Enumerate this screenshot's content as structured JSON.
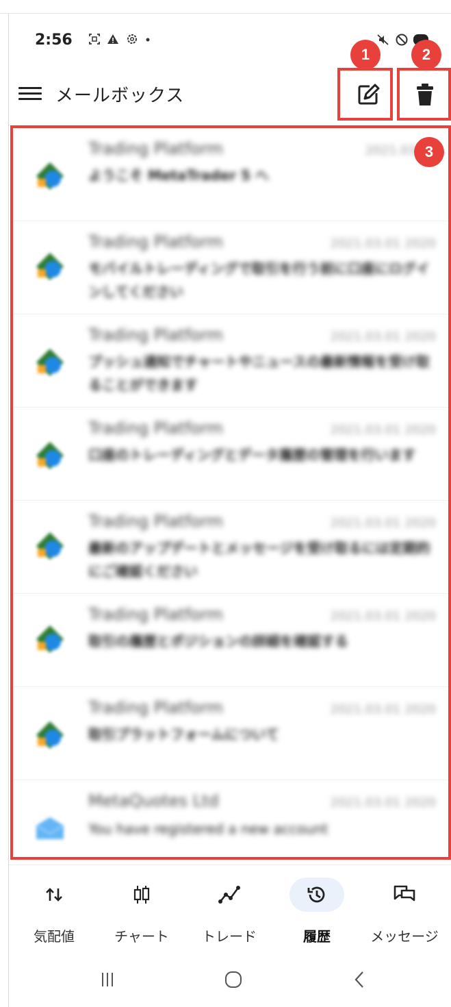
{
  "status_bar": {
    "time": "2:56",
    "left_icons": [
      "screenshot-icon",
      "warning-icon",
      "settings-icon",
      "dot-icon"
    ],
    "right_icons": [
      "mute-icon",
      "do-not-disturb-icon",
      "battery-icon"
    ]
  },
  "app_bar": {
    "title": "メールボックス",
    "compose_icon": "compose-icon",
    "delete_icon": "trash-icon"
  },
  "annotations": {
    "badge_1": "1",
    "badge_2": "2",
    "badge_3": "3",
    "color": "#e8403a"
  },
  "mail_list": {
    "items": [
      {
        "sender": "Trading Platform",
        "date": "2021.03.01",
        "subject": "ようこそ MetaTrader 5 へ"
      },
      {
        "sender": "Trading Platform",
        "date": "2021.03.01 2020",
        "subject": "モバイルトレーディングで取引を行う前に口座にログインしてください"
      },
      {
        "sender": "Trading Platform",
        "date": "2021.03.01 2020",
        "subject": "プッシュ通知でチャートやニュースの最新情報を受け取ることができます"
      },
      {
        "sender": "Trading Platform",
        "date": "2021.03.01 2020",
        "subject": "口座のトレーディングとデータ履歴の管理を行います"
      },
      {
        "sender": "Trading Platform",
        "date": "2021.03.01 2020",
        "subject": "最新のアップデートとメッセージを受け取るには定期的にご確認ください"
      },
      {
        "sender": "Trading Platform",
        "date": "2021.03.01 2020",
        "subject": "取引の履歴とポジションの詳細を確認する"
      },
      {
        "sender": "Trading Platform",
        "date": "2021.03.01 2020",
        "subject": "取引プラットフォームについて"
      },
      {
        "sender": "MetaQuotes Ltd",
        "date": "2021.03.01 2020",
        "subject": "You have registered a new account"
      }
    ]
  },
  "bottom_nav": {
    "items": [
      {
        "label": "気配値",
        "icon": "quotes-arrows-icon"
      },
      {
        "label": "チャート",
        "icon": "candlestick-icon"
      },
      {
        "label": "トレード",
        "icon": "trade-line-icon"
      },
      {
        "label": "履歴",
        "icon": "history-icon",
        "active": true
      },
      {
        "label": "メッセージ",
        "icon": "messages-icon"
      }
    ],
    "active_pill_color": "#eaf1fb"
  },
  "system_nav": {
    "buttons": [
      "recent-apps-icon",
      "home-icon",
      "back-icon"
    ]
  }
}
